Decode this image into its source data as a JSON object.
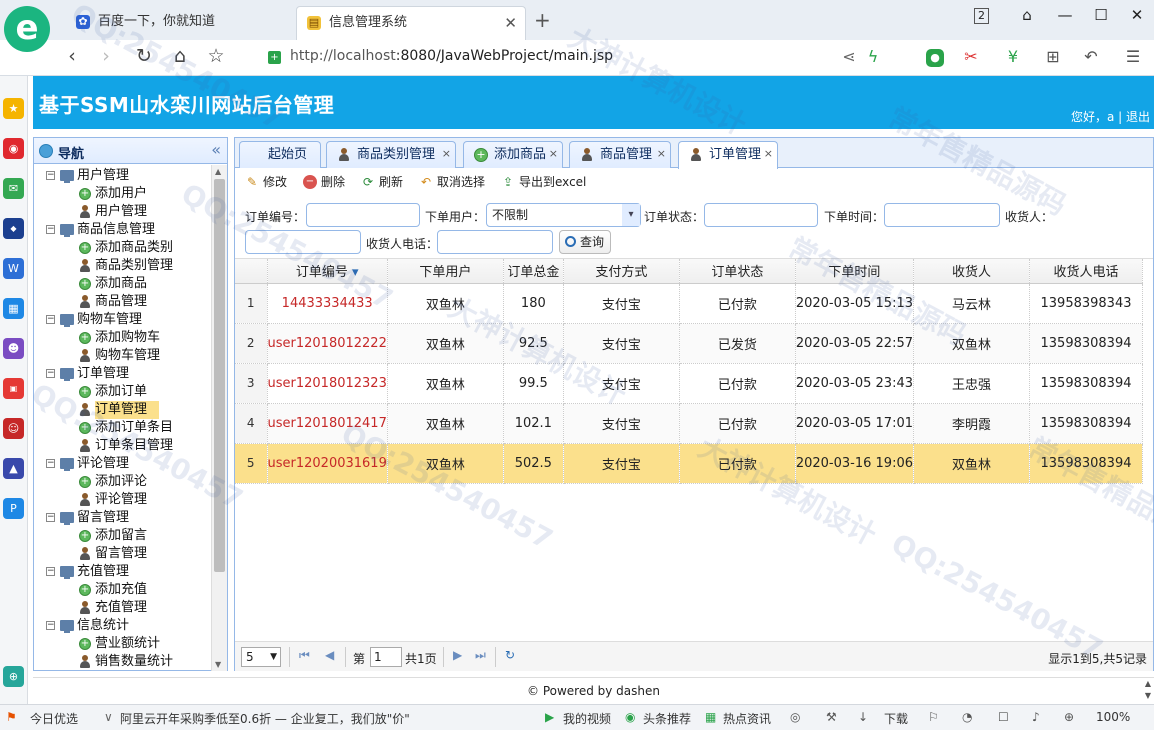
{
  "browser": {
    "tabs": [
      {
        "title": "百度一下，你就知道",
        "icon": "paw-icon"
      },
      {
        "title": "信息管理系统",
        "icon": "page-icon"
      }
    ],
    "new_tab": "+",
    "url_host": "http://localhost",
    "url_rest": ":8080/JavaWebProject/main.jsp",
    "tab_count": "2",
    "zoom": "100%",
    "status_items": [
      "今日优选",
      "阿里云开年采购季低至0.6折 — 企业复工，我们放\"价\"",
      "我的视频",
      "头条推荐",
      "热点资讯",
      "下载"
    ]
  },
  "app": {
    "title": "基于SSM山水栾川网站后台管理",
    "welcome": "您好，a | 退出",
    "nav_title": "导航",
    "footer": "© Powered by dashen"
  },
  "tree": [
    {
      "type": "group",
      "label": "用户管理"
    },
    {
      "type": "add",
      "label": "添加用户"
    },
    {
      "type": "user",
      "label": "用户管理"
    },
    {
      "type": "group",
      "label": "商品信息管理"
    },
    {
      "type": "add",
      "label": "添加商品类别"
    },
    {
      "type": "user",
      "label": "商品类别管理"
    },
    {
      "type": "add",
      "label": "添加商品"
    },
    {
      "type": "user",
      "label": "商品管理"
    },
    {
      "type": "group",
      "label": "购物车管理"
    },
    {
      "type": "add",
      "label": "添加购物车"
    },
    {
      "type": "user",
      "label": "购物车管理"
    },
    {
      "type": "group",
      "label": "订单管理"
    },
    {
      "type": "add",
      "label": "添加订单"
    },
    {
      "type": "user",
      "label": "订单管理",
      "selected": true
    },
    {
      "type": "add",
      "label": "添加订单条目"
    },
    {
      "type": "user",
      "label": "订单条目管理"
    },
    {
      "type": "group",
      "label": "评论管理"
    },
    {
      "type": "add",
      "label": "添加评论"
    },
    {
      "type": "user",
      "label": "评论管理"
    },
    {
      "type": "group",
      "label": "留言管理"
    },
    {
      "type": "add",
      "label": "添加留言"
    },
    {
      "type": "user",
      "label": "留言管理"
    },
    {
      "type": "group",
      "label": "充值管理"
    },
    {
      "type": "add",
      "label": "添加充值"
    },
    {
      "type": "user",
      "label": "充值管理"
    },
    {
      "type": "group",
      "label": "信息统计"
    },
    {
      "type": "add",
      "label": "营业额统计"
    },
    {
      "type": "user",
      "label": "销售数量统计"
    }
  ],
  "tabs": [
    "起始页",
    "商品类别管理",
    "添加商品",
    "商品管理",
    "订单管理"
  ],
  "toolbar": {
    "edit": "修改",
    "delete": "删除",
    "refresh": "刷新",
    "cancel": "取消选择",
    "export": "导出到excel"
  },
  "search": {
    "order_no_label": "订单编号：",
    "user_label": "下单用户：",
    "user_value": "不限制",
    "status_label": "订单状态：",
    "time_label": "下单时间：",
    "receiver_label": "收货人：",
    "phone_label": "收货人电话：",
    "query_button": "查询"
  },
  "grid": {
    "columns": [
      "订单编号",
      "下单用户",
      "订单总金",
      "支付方式",
      "订单状态",
      "下单时间",
      "收货人",
      "收货人电话"
    ],
    "rows": [
      [
        "1",
        "14433334433",
        "双鱼林",
        "180",
        "支付宝",
        "已付款",
        "2020-03-05 15:13",
        "马云林",
        "13958398343"
      ],
      [
        "2",
        "user12018012222",
        "双鱼林",
        "92.5",
        "支付宝",
        "已发货",
        "2020-03-05 22:57",
        "双鱼林",
        "13598308394"
      ],
      [
        "3",
        "user12018012323",
        "双鱼林",
        "99.5",
        "支付宝",
        "已付款",
        "2020-03-05 23:43",
        "王忠强",
        "13598308394"
      ],
      [
        "4",
        "user12018012417",
        "双鱼林",
        "102.1",
        "支付宝",
        "已付款",
        "2020-03-05 17:01",
        "李明霞",
        "13598308394"
      ],
      [
        "5",
        "user12020031619",
        "双鱼林",
        "502.5",
        "支付宝",
        "已付款",
        "2020-03-16 19:06",
        "双鱼林",
        "13598308394"
      ]
    ],
    "highlighted_row": 5
  },
  "pager": {
    "page_size": "5",
    "page_label": "第",
    "page": "1",
    "total_pages": "共1页",
    "info": "显示1到5,共5记录"
  },
  "watermarks": [
    "QQ:254540457",
    "大神计算机设计",
    "常年售精品源码",
    "QQ:254540457",
    "大神计算机设计",
    "常年售精品源码",
    "QQ:254540457",
    "QQ:254540457",
    "大神计算机设计",
    "常年售精品源码",
    "QQ:254540457"
  ],
  "colors": {
    "header": "#12a4e6",
    "highlight": "#fbe08c",
    "order_no": "#c62828",
    "panel_border": "#95b8e7"
  }
}
